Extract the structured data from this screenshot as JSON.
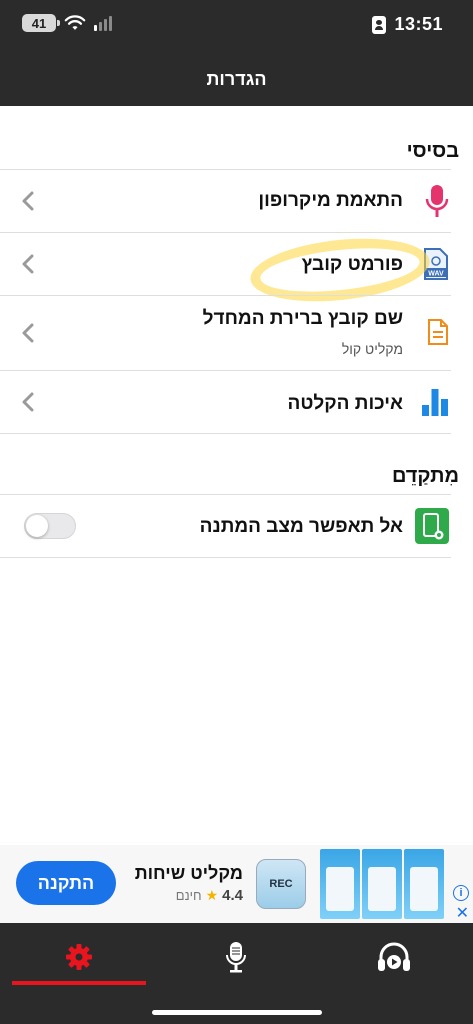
{
  "status_bar": {
    "battery": "41",
    "time": "13:51"
  },
  "header": {
    "title": "הגדרות"
  },
  "sections": {
    "basic": {
      "title": "בסיסי",
      "items": [
        {
          "label": "התאמת מיקרופון",
          "icon": "microphone-icon"
        },
        {
          "label": "פורמט קובץ",
          "icon": "wav-file-icon"
        },
        {
          "label": "שם קובץ ברירת המחדל",
          "sublabel": "מקליט קול",
          "icon": "document-icon"
        },
        {
          "label": "איכות הקלטה",
          "icon": "bar-chart-icon"
        }
      ]
    },
    "advanced": {
      "title": "מִתקַדֵם",
      "items": [
        {
          "label": "אל תאפשר מצב המתנה",
          "icon": "screen-lock-icon",
          "toggle_on": false
        }
      ]
    }
  },
  "ad": {
    "app_name": "מקליט שיחות",
    "rating": "4.4",
    "price": "חינם",
    "install_label": "התקנה",
    "icon_text": "REC"
  },
  "tab_bar": {
    "tabs": [
      "settings-icon",
      "microphone-icon",
      "headphones-play-icon"
    ],
    "active": 0
  },
  "colors": {
    "header_bg": "#2b2b2b",
    "accent_red": "#e8141e",
    "mic_pink": "#e5336d",
    "install_blue": "#1a73e8",
    "chart_blue": "#1e88e5",
    "toggle_icon_green": "#2eaa4a"
  }
}
